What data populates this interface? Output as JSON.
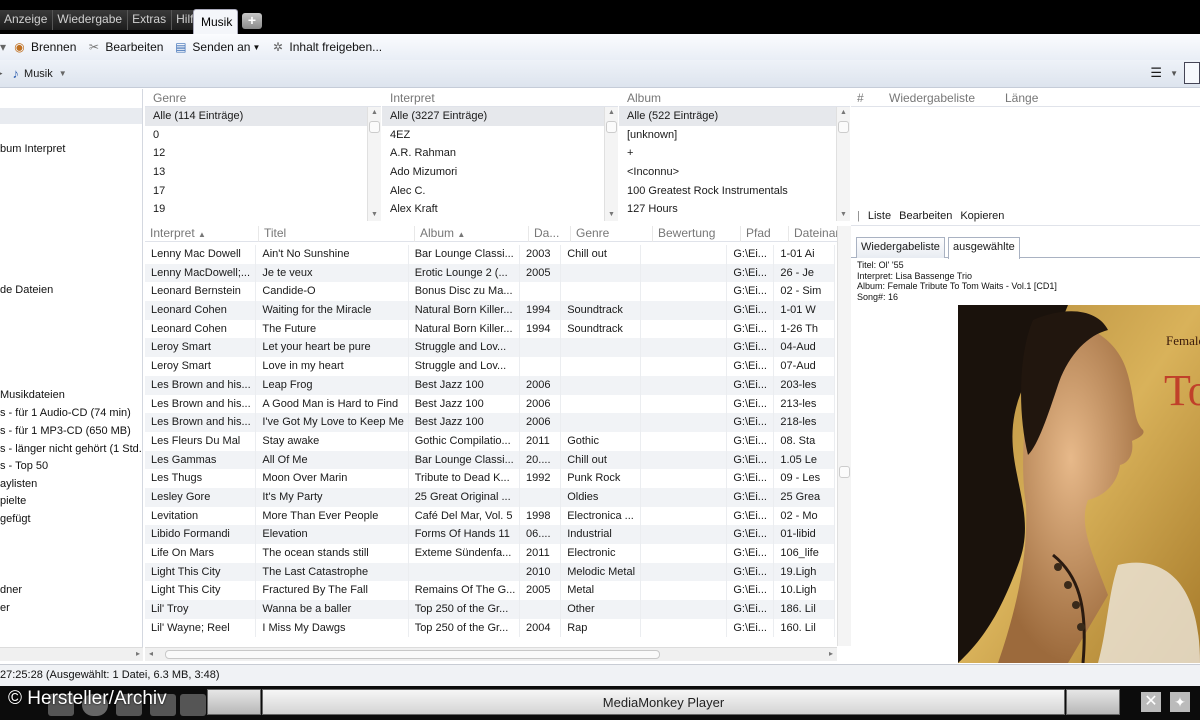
{
  "menu": {
    "items": [
      "Anzeige",
      "Wiedergabe",
      "Extras",
      "Hilfe"
    ],
    "active_tab": "Musik",
    "add_tab": "+"
  },
  "toolbar": {
    "burn": "Brennen",
    "edit": "Bearbeiten",
    "send": "Senden an",
    "share": "Inhalt freigeben..."
  },
  "nav": {
    "crumb": "Musik"
  },
  "tree": {
    "items": [
      "bum Interpret",
      "de Dateien",
      "Musikdateien",
      "s - für 1 Audio-CD (74 min)",
      "s - für 1 MP3-CD (650 MB)",
      "s - länger nicht gehört (1 Std.",
      "s - Top 50",
      "aylisten",
      "pielte",
      "gefügt",
      "dner",
      "er"
    ]
  },
  "filters": {
    "genre": {
      "header": "Genre",
      "rows": [
        "Alle (114 Einträge)",
        "0",
        "12",
        "13",
        "17",
        "19"
      ]
    },
    "artist": {
      "header": "Interpret",
      "rows": [
        "Alle (3227 Einträge)",
        "4EZ",
        "A.R. Rahman",
        "Ado Mizumori",
        "Alec C.",
        "Alex Kraft"
      ]
    },
    "album": {
      "header": "Album",
      "rows": [
        "Alle (522 Einträge)",
        "[unknown]",
        "+",
        "<Inconnu>",
        "100 Greatest Rock Instrumentals",
        "127 Hours"
      ]
    }
  },
  "playlist": {
    "headers": [
      "#",
      "Wiedergabeliste",
      "Länge"
    ],
    "tools": [
      "Liste",
      "Bearbeiten",
      "Kopieren"
    ]
  },
  "info": {
    "tabs": [
      "Wiedergabeliste",
      "ausgewählte"
    ],
    "title": "Titel: Ol' '55",
    "artist": "Interpret: Lisa Bassenge Trio",
    "album": "Album: Female Tribute To Tom Waits - Vol.1 [CD1]",
    "song": "Song#: 16",
    "art_text_1": "Female",
    "art_text_2": "To"
  },
  "tracks": {
    "headers": [
      "Interpret",
      "Titel",
      "Album",
      "Da...",
      "Genre",
      "Bewertung",
      "Pfad",
      "Dateinam"
    ],
    "rows": [
      [
        "Lenny Mac Dowell",
        "Ain't No Sunshine",
        "Bar Lounge Classi...",
        "2003",
        "Chill out",
        "",
        "G:\\Ei...",
        "1-01 Ai"
      ],
      [
        "Lenny MacDowell;...",
        "Je te veux",
        "Erotic Lounge 2 (...",
        "2005",
        "",
        "",
        "G:\\Ei...",
        "26 - Je"
      ],
      [
        "Leonard Bernstein",
        "Candide-O",
        "Bonus Disc zu Ma...",
        "",
        "",
        "",
        "G:\\Ei...",
        "02 - Sim"
      ],
      [
        "Leonard Cohen",
        "Waiting for the Miracle",
        "Natural Born Killer...",
        "1994",
        "Soundtrack",
        "",
        "G:\\Ei...",
        "1-01 W"
      ],
      [
        "Leonard Cohen",
        "The Future",
        "Natural Born Killer...",
        "1994",
        "Soundtrack",
        "",
        "G:\\Ei...",
        "1-26 Th"
      ],
      [
        "Leroy Smart",
        "Let your heart be pure",
        "Struggle and Lov...",
        "",
        "",
        "",
        "G:\\Ei...",
        "04-Aud"
      ],
      [
        "Leroy Smart",
        "Love in my heart",
        "Struggle and Lov...",
        "",
        "",
        "",
        "G:\\Ei...",
        "07-Aud"
      ],
      [
        "Les Brown and his...",
        "Leap Frog",
        "Best Jazz 100",
        "2006",
        "",
        "",
        "G:\\Ei...",
        "203-les"
      ],
      [
        "Les Brown and his...",
        "A Good Man is Hard to Find",
        "Best Jazz 100",
        "2006",
        "",
        "",
        "G:\\Ei...",
        "213-les"
      ],
      [
        "Les Brown and his...",
        "I've Got My Love to Keep Me",
        "Best Jazz 100",
        "2006",
        "",
        "",
        "G:\\Ei...",
        "218-les"
      ],
      [
        "Les Fleurs Du Mal",
        "Stay awake",
        "Gothic Compilatio...",
        "2011",
        "Gothic",
        "",
        "G:\\Ei...",
        "08. Sta"
      ],
      [
        "Les Gammas",
        "All Of Me",
        "Bar Lounge Classi...",
        "20....",
        "Chill out",
        "",
        "G:\\Ei...",
        "1.05 Le"
      ],
      [
        "Les Thugs",
        "Moon Over Marin",
        "Tribute to Dead K...",
        "1992",
        "Punk Rock",
        "",
        "G:\\Ei...",
        "09 - Les"
      ],
      [
        "Lesley Gore",
        "It's My Party",
        "25 Great Original ...",
        "",
        "Oldies",
        "",
        "G:\\Ei...",
        "25 Grea"
      ],
      [
        "Levitation",
        "More Than Ever People",
        "Café Del Mar, Vol. 5",
        "1998",
        "Electronica ...",
        "",
        "G:\\Ei...",
        "02 - Mo"
      ],
      [
        "Libido Formandi",
        "Elevation",
        "Forms Of Hands 11",
        "06....",
        "Industrial",
        "",
        "G:\\Ei...",
        "01-libid"
      ],
      [
        "Life On Mars",
        "The ocean stands still",
        "Exteme Sündenfa...",
        "2011",
        "Electronic",
        "",
        "G:\\Ei...",
        "106_life"
      ],
      [
        "Light This City",
        "The Last Catastrophe",
        "",
        "2010",
        "Melodic Metal",
        "",
        "G:\\Ei...",
        "19.Ligh"
      ],
      [
        "Light This City",
        "Fractured By The Fall",
        "Remains Of The G...",
        "2005",
        "Metal",
        "",
        "G:\\Ei...",
        "10.Ligh"
      ],
      [
        "Lil' Troy",
        "Wanna be a baller",
        "Top 250 of the Gr...",
        "",
        "Other",
        "",
        "G:\\Ei...",
        "186. Lil"
      ],
      [
        "Lil' Wayne; Reel",
        "I Miss My Dawgs",
        "Top 250 of the Gr...",
        "2004",
        "Rap",
        "",
        "G:\\Ei...",
        "160. Lil"
      ]
    ]
  },
  "status": {
    "text": "27:25:28 (Ausgewählt: 1 Datei, 6.3 MB, 3:48)"
  },
  "player": {
    "title": "MediaMonkey Player"
  },
  "watermark": "© Hersteller/Archiv"
}
